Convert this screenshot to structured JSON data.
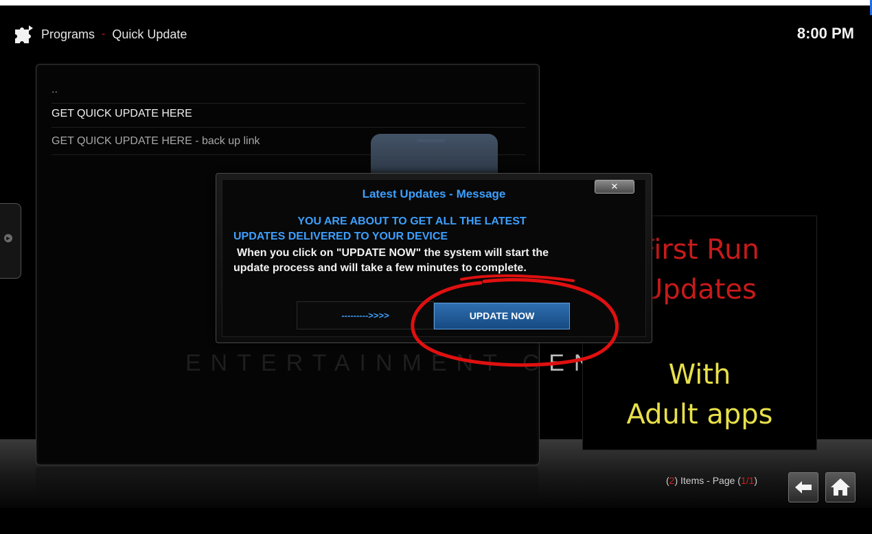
{
  "header": {
    "section": "Programs",
    "separator": "-",
    "page": "Quick Update",
    "clock": "8:00 PM",
    "icon": "puzzle-piece-icon"
  },
  "list": {
    "items": [
      {
        "label": ".."
      },
      {
        "label": "GET QUICK UPDATE HERE"
      },
      {
        "label": "GET QUICK UPDATE HERE - back up link"
      }
    ]
  },
  "background": {
    "watermark_dim": "ENTERTAINMENT C",
    "watermark_bright": "EN"
  },
  "preview": {
    "line1": "First Run",
    "line2": "Updates",
    "line3": "With",
    "line4": "Adult apps"
  },
  "dialog": {
    "title": "Latest Updates  - Message",
    "close_label": "✕",
    "line1": "YOU ARE ABOUT TO GET ALL THE LATEST",
    "line2": "UPDATES DELIVERED TO YOUR DEVICE",
    "line3": "When you click on \"UPDATE NOW\" the system will start the",
    "line4": "update process and will take a few minutes to complete.",
    "secondary_button": "--------->>>>",
    "primary_button": "UPDATE NOW"
  },
  "footer": {
    "count_open": "(",
    "count": "2",
    "count_text": ") Items - Page (",
    "page_current": "1/1",
    "page_close": ")",
    "back_icon": "arrow-left-icon",
    "home_icon": "home-icon"
  },
  "colors": {
    "accent_blue": "#3da0ff",
    "accent_red": "#d02020",
    "annotation_red": "#e01010"
  }
}
